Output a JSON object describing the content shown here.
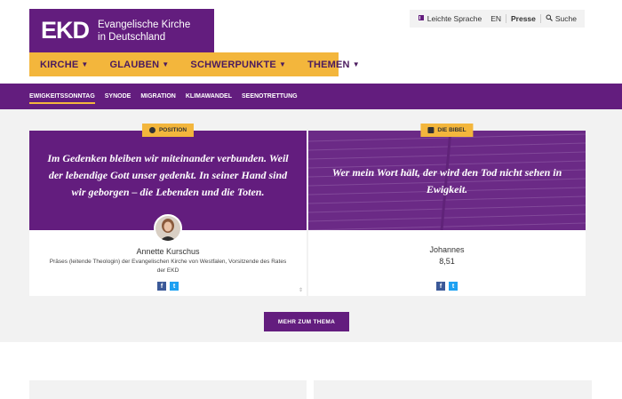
{
  "header": {
    "logo_mark": "EKD",
    "logo_line1": "Evangelische Kirche",
    "logo_line2": "in Deutschland",
    "top_links": {
      "easy_language": "Leichte Sprache",
      "english": "EN",
      "press": "Presse",
      "search": "Suche"
    }
  },
  "main_nav": [
    {
      "label": "KIRCHE"
    },
    {
      "label": "GLAUBEN"
    },
    {
      "label": "SCHWERPUNKTE"
    },
    {
      "label": "THEMEN"
    }
  ],
  "sub_nav": [
    {
      "label": "EWIGKEITSSONNTAG",
      "active": true
    },
    {
      "label": "SYNODE"
    },
    {
      "label": "MIGRATION"
    },
    {
      "label": "KLIMAWANDEL"
    },
    {
      "label": "SEENOTRETTUNG"
    }
  ],
  "cards": {
    "position": {
      "tag": "POSITION",
      "quote": "Im Gedenken bleiben wir miteinander verbunden. Weil der lebendige Gott unser gedenkt. In seiner Hand sind wir geborgen – die Lebenden und die Toten.",
      "name": "Annette Kurschus",
      "role": "Präses (leitende Theologin) der Evangelischen Kirche von Westfalen, Vorsitzende des Rates der EKD"
    },
    "bible": {
      "tag": "DIE BIBEL",
      "quote": "Wer mein Wort hält, der wird den Tod nicht sehen in Ewigkeit.",
      "book": "Johannes",
      "reference": "8,51"
    }
  },
  "more_button": "MEHR ZUM THEMA",
  "colors": {
    "purple": "#631d7e",
    "yellow": "#f3b63c",
    "light_gray": "#f2f2f2"
  }
}
